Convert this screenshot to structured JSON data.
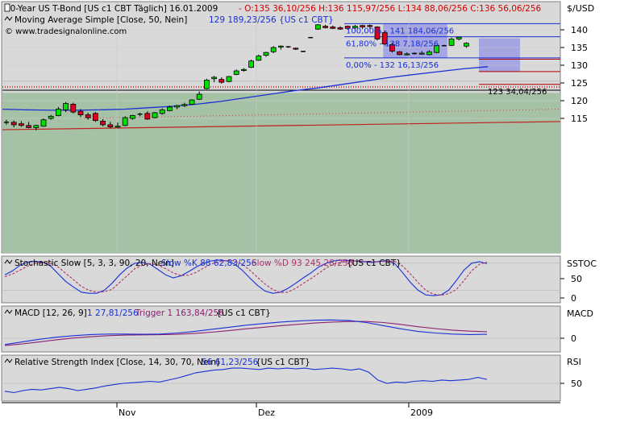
{
  "main": {
    "title": "30-Year US T-Bond [US c1 CBT  Täglich] 16.01.2009",
    "ohlc_info": "- O:135 36,10/256 H:136 115,97/256 L:134 88,06/256 C:136 56,06/256",
    "ma_label": "Moving Average Simple [Close, 50, Nein]",
    "ma_value": "129 189,23/256 {US c1 CBT}",
    "copyright": "© www.tradesignalonline.com",
    "unit": "$/USD",
    "y_ticks": [
      "140",
      "135",
      "130",
      "125",
      "120",
      "115"
    ],
    "fib_labels": [
      "100,00% - 141 184,06/256",
      "61,80% - 138 7,18/256",
      "0,00% - 132 16,13/256"
    ],
    "price_label": "123 34,04/256"
  },
  "stochastic": {
    "label": "Stochastic Slow [5, 3, 3, 90, 20, Nein]",
    "k_label": "Slow %K 88 62,83/256",
    "d_label": "Slow %D 93 245,28/256",
    "suffix": "{US c1 CBT}",
    "panel_name": "SSTOC",
    "ticks": [
      "50",
      "0"
    ]
  },
  "macd": {
    "label": "MACD [12, 26, 9]",
    "value": "1 27,81/256",
    "trigger": "Trigger 1 163,84/256",
    "suffix": "{US c1 CBT}",
    "panel_name": "MACD",
    "ticks": [
      "0"
    ]
  },
  "rsi": {
    "label": "Relative Strength Index [Close, 14, 30, 70, Nein]",
    "value": "56 61,23/256",
    "suffix": "{US c1 CBT}",
    "panel_name": "RSI",
    "ticks": [
      "50"
    ]
  },
  "x_labels": [
    "Nov",
    "Dez",
    "2009"
  ],
  "colors": {
    "panel_bg": "#d9d9d9",
    "band_fill": "#a6c2a6",
    "up_candle": "#00e000",
    "down_candle": "#e00020",
    "ma_line": "#1a2fd6",
    "fib_box": "#8f8fe6",
    "hline_blue": "#1a2fd6",
    "hline_red": "#b00000",
    "k_line": "#1a2fd6",
    "d_line": "#b0306a",
    "macd_line": "#1a2fd6",
    "trigger_line": "#8a2070",
    "rsi_line": "#1a2fd6"
  },
  "chart_data": [
    {
      "type": "candlestick",
      "title": "30-Year US T-Bond [US c1 CBT  Täglich] 16.01.2009",
      "ylabel": "$/USD",
      "ylim": [
        112,
        142.5
      ],
      "x_tick_labels": [
        "Nov",
        "Dez",
        "2009"
      ],
      "candles": [
        {
          "o": 114.0,
          "h": 114.6,
          "l": 113.2,
          "c": 113.9
        },
        {
          "o": 113.9,
          "h": 114.4,
          "l": 112.5,
          "c": 113.2
        },
        {
          "o": 113.5,
          "h": 114.2,
          "l": 112.6,
          "c": 113.0
        },
        {
          "o": 113.0,
          "h": 114.0,
          "l": 112.2,
          "c": 112.4
        },
        {
          "o": 112.4,
          "h": 113.2,
          "l": 111.6,
          "c": 113.0
        },
        {
          "o": 112.8,
          "h": 115.0,
          "l": 112.6,
          "c": 114.6
        },
        {
          "o": 115.0,
          "h": 116.0,
          "l": 114.6,
          "c": 115.6
        },
        {
          "o": 115.8,
          "h": 118.2,
          "l": 115.6,
          "c": 117.6
        },
        {
          "o": 117.4,
          "h": 119.6,
          "l": 116.8,
          "c": 119.2
        },
        {
          "o": 119.0,
          "h": 119.4,
          "l": 116.4,
          "c": 116.8
        },
        {
          "o": 117.0,
          "h": 117.6,
          "l": 115.4,
          "c": 116.0
        },
        {
          "o": 116.0,
          "h": 116.6,
          "l": 114.6,
          "c": 115.2
        },
        {
          "o": 116.4,
          "h": 116.8,
          "l": 114.0,
          "c": 114.4
        },
        {
          "o": 114.2,
          "h": 114.8,
          "l": 112.8,
          "c": 113.2
        },
        {
          "o": 113.2,
          "h": 114.0,
          "l": 112.2,
          "c": 112.6
        },
        {
          "o": 112.6,
          "h": 113.8,
          "l": 112.2,
          "c": 112.8
        },
        {
          "o": 113.0,
          "h": 115.6,
          "l": 112.8,
          "c": 115.2
        },
        {
          "o": 115.0,
          "h": 116.0,
          "l": 114.6,
          "c": 115.8
        },
        {
          "o": 116.2,
          "h": 116.6,
          "l": 115.6,
          "c": 116.2
        },
        {
          "o": 116.4,
          "h": 117.0,
          "l": 114.6,
          "c": 114.8
        },
        {
          "o": 115.2,
          "h": 116.8,
          "l": 115.0,
          "c": 116.6
        },
        {
          "o": 116.4,
          "h": 117.8,
          "l": 116.0,
          "c": 117.4
        },
        {
          "o": 117.2,
          "h": 118.6,
          "l": 117.0,
          "c": 118.2
        },
        {
          "o": 118.2,
          "h": 118.8,
          "l": 117.6,
          "c": 118.6
        },
        {
          "o": 118.6,
          "h": 119.4,
          "l": 118.2,
          "c": 118.9
        },
        {
          "o": 119.0,
          "h": 120.4,
          "l": 118.8,
          "c": 120.2
        },
        {
          "o": 120.4,
          "h": 122.6,
          "l": 120.2,
          "c": 121.8
        },
        {
          "o": 123.4,
          "h": 126.2,
          "l": 123.2,
          "c": 125.8
        },
        {
          "o": 126.2,
          "h": 127.0,
          "l": 125.2,
          "c": 126.6
        },
        {
          "o": 126.0,
          "h": 126.6,
          "l": 124.8,
          "c": 125.2
        },
        {
          "o": 125.4,
          "h": 127.0,
          "l": 125.2,
          "c": 126.8
        },
        {
          "o": 127.4,
          "h": 128.8,
          "l": 127.2,
          "c": 128.4
        },
        {
          "o": 128.6,
          "h": 129.2,
          "l": 128.2,
          "c": 128.8
        },
        {
          "o": 129.4,
          "h": 131.6,
          "l": 129.2,
          "c": 131.2
        },
        {
          "o": 131.4,
          "h": 133.0,
          "l": 131.2,
          "c": 132.6
        },
        {
          "o": 132.8,
          "h": 133.8,
          "l": 132.4,
          "c": 133.6
        },
        {
          "o": 133.8,
          "h": 135.4,
          "l": 133.4,
          "c": 135.0
        },
        {
          "o": 135.2,
          "h": 135.6,
          "l": 134.4,
          "c": 135.4
        },
        {
          "o": 135.2,
          "h": 135.4,
          "l": 134.9,
          "c": 135.2
        },
        {
          "o": 134.8,
          "h": 135.0,
          "l": 134.3,
          "c": 134.6
        },
        {
          "o": 133.9,
          "h": 134.1,
          "l": 133.7,
          "c": 133.9
        },
        {
          "o": 137.8,
          "h": 138.0,
          "l": 137.6,
          "c": 137.8
        },
        {
          "o": 140.2,
          "h": 141.6,
          "l": 140.0,
          "c": 141.4
        },
        {
          "o": 141.0,
          "h": 141.4,
          "l": 140.4,
          "c": 140.6
        },
        {
          "o": 140.8,
          "h": 141.2,
          "l": 140.2,
          "c": 140.4
        },
        {
          "o": 140.6,
          "h": 141.0,
          "l": 140.0,
          "c": 140.2
        },
        {
          "o": 141.0,
          "h": 141.2,
          "l": 140.0,
          "c": 140.4
        },
        {
          "o": 140.6,
          "h": 141.4,
          "l": 140.2,
          "c": 141.0
        },
        {
          "o": 141.2,
          "h": 141.4,
          "l": 140.2,
          "c": 140.8
        },
        {
          "o": 141.2,
          "h": 141.5,
          "l": 140.2,
          "c": 141.0
        },
        {
          "o": 140.8,
          "h": 141.0,
          "l": 137.0,
          "c": 137.4
        },
        {
          "o": 139.2,
          "h": 139.8,
          "l": 135.6,
          "c": 136.0
        },
        {
          "o": 135.8,
          "h": 136.4,
          "l": 133.6,
          "c": 134.0
        },
        {
          "o": 133.8,
          "h": 134.0,
          "l": 132.8,
          "c": 133.0
        },
        {
          "o": 133.0,
          "h": 133.6,
          "l": 132.8,
          "c": 133.2
        },
        {
          "o": 133.4,
          "h": 133.6,
          "l": 133.0,
          "c": 133.3
        },
        {
          "o": 133.2,
          "h": 134.0,
          "l": 133.0,
          "c": 133.4
        },
        {
          "o": 133.0,
          "h": 134.2,
          "l": 132.8,
          "c": 133.8
        },
        {
          "o": 133.6,
          "h": 135.8,
          "l": 133.4,
          "c": 135.6
        },
        {
          "o": 135.6,
          "h": 135.8,
          "l": 135.4,
          "c": 135.5
        },
        {
          "o": 135.6,
          "h": 137.8,
          "l": 135.4,
          "c": 137.4
        },
        {
          "o": 137.4,
          "h": 138.0,
          "l": 137.0,
          "c": 137.9
        },
        {
          "o": 135.4,
          "h": 136.5,
          "l": 134.9,
          "c": 136.2
        }
      ],
      "moving_average_50": [
        117.6,
        117.4,
        117.3,
        117.3,
        117.4,
        117.6,
        118.0,
        118.4,
        119.0,
        119.8,
        120.8,
        121.8,
        122.8,
        123.6,
        124.6,
        125.6,
        126.6,
        127.4,
        128.2,
        129.0,
        129.6
      ],
      "fibonacci": {
        "high": 141.72,
        "mid": 138.03,
        "low": 132.06,
        "labels": [
          "100,00%",
          "61,80%",
          "0,00%"
        ]
      },
      "horizontal_levels": [
        131.7,
        128.2,
        124.6,
        124.0,
        123.7,
        123.13
      ],
      "price_marker": 123.13,
      "price_marker_label": "123 34,04/256",
      "ma_label": "Moving Average Simple [Close, 50, Nein]",
      "ma_value": "129 189,23/256"
    },
    {
      "type": "line",
      "title": "Stochastic Slow [5, 3, 3, 90, 20, Nein]",
      "ylim": [
        -5,
        105
      ],
      "series": [
        {
          "name": "Slow %K",
          "values": [
            60,
            70,
            85,
            93,
            95,
            92,
            82,
            62,
            42,
            28,
            15,
            12,
            12,
            20,
            38,
            60,
            78,
            90,
            92,
            87,
            74,
            60,
            52,
            57,
            68,
            80,
            90,
            96,
            98,
            96,
            88,
            72,
            52,
            33,
            18,
            12,
            15,
            25,
            38,
            52,
            65,
            80,
            90,
            96,
            98,
            97,
            95,
            94,
            92,
            95,
            96,
            88,
            65,
            40,
            20,
            8,
            6,
            8,
            20,
            45,
            72,
            90,
            94,
            89
          ]
        },
        {
          "name": "Slow %D",
          "values": [
            55,
            62,
            72,
            83,
            90,
            93,
            90,
            80,
            63,
            47,
            30,
            20,
            15,
            16,
            22,
            40,
            58,
            76,
            85,
            89,
            85,
            76,
            65,
            58,
            59,
            66,
            78,
            88,
            94,
            97,
            96,
            88,
            72,
            54,
            36,
            22,
            14,
            15,
            25,
            38,
            50,
            64,
            78,
            88,
            93,
            96,
            96,
            95,
            94,
            94,
            95,
            94,
            82,
            62,
            40,
            20,
            10,
            7,
            11,
            22,
            45,
            70,
            87,
            93
          ]
        }
      ],
      "y_ticks": [
        50,
        0
      ]
    },
    {
      "type": "line",
      "title": "MACD [12, 26, 9]",
      "ylim": [
        -1.6,
        2.2
      ],
      "series": [
        {
          "name": "MACD",
          "values": [
            -0.6,
            -0.35,
            -0.1,
            0.1,
            0.25,
            0.35,
            0.4,
            0.4,
            0.38,
            0.4,
            0.5,
            0.65,
            0.85,
            1.05,
            1.25,
            1.4,
            1.55,
            1.65,
            1.72,
            1.75,
            1.7,
            1.5,
            1.2,
            0.9,
            0.65,
            0.5,
            0.4,
            0.35,
            0.38
          ]
        },
        {
          "name": "Trigger",
          "values": [
            -0.7,
            -0.55,
            -0.35,
            -0.15,
            0.02,
            0.15,
            0.25,
            0.3,
            0.32,
            0.34,
            0.38,
            0.45,
            0.58,
            0.72,
            0.9,
            1.05,
            1.2,
            1.32,
            1.45,
            1.55,
            1.6,
            1.6,
            1.5,
            1.32,
            1.1,
            0.92,
            0.78,
            0.68,
            0.62
          ]
        }
      ],
      "y_ticks": [
        0
      ]
    },
    {
      "type": "line",
      "title": "Relative Strength Index [Close, 14, 30, 70, Nein]",
      "ylim": [
        28,
        78
      ],
      "series": [
        {
          "name": "RSI",
          "values": [
            38,
            36,
            39,
            41,
            40,
            42,
            44,
            42,
            39,
            41,
            43,
            46,
            48,
            50,
            51,
            52,
            53,
            52,
            55,
            58,
            62,
            66,
            68,
            70,
            71,
            73,
            73,
            72,
            71,
            73,
            72,
            73,
            72,
            73,
            71,
            72,
            73,
            72,
            70,
            72,
            67,
            55,
            50,
            52,
            51,
            53,
            54,
            53,
            55,
            54,
            55,
            56,
            59,
            56
          ]
        }
      ],
      "y_ticks": [
        50
      ]
    }
  ]
}
